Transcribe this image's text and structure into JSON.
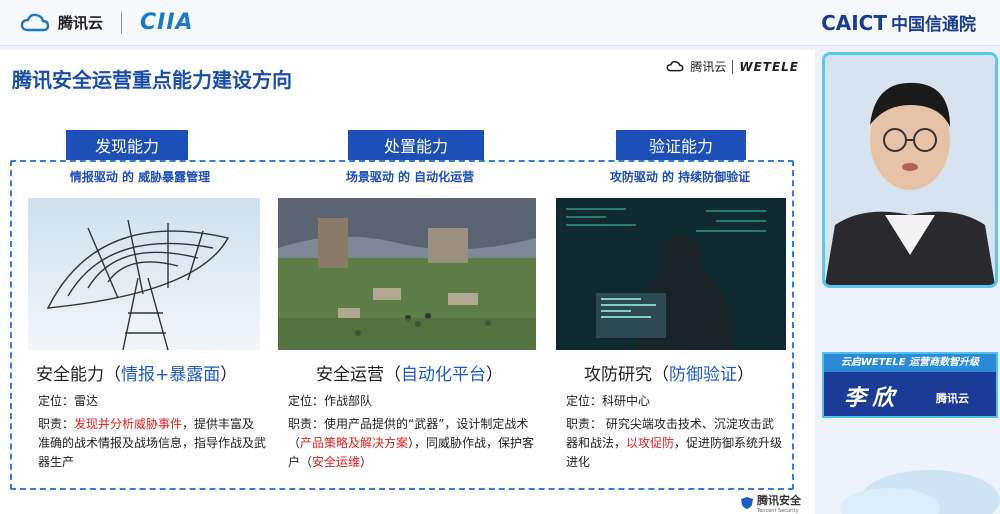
{
  "header": {
    "brand_name": "腾讯云",
    "event_logo": "CIIA",
    "org_en": "CAICT",
    "org_cn": "中国信通院"
  },
  "slide": {
    "title": "腾讯安全运营重点能力建设方向",
    "logo_brand": "腾讯云",
    "logo_partner": "WETELE",
    "footer_brand": "腾讯安全",
    "footer_brand_en": "Tencent Security",
    "columns": [
      {
        "capability": "发现能力",
        "subtitle": "情报驱动 的 威胁暴露管理",
        "image": "radar-image",
        "title_main": "安全能力（",
        "title_highlight": "情报+暴露面",
        "title_end": "）",
        "position": "定位：雷达",
        "duty_prefix": "职责：",
        "duty_red": "发现并分析威胁事件",
        "duty_rest": "，提供丰富及准确的战术情报及战场信息，指导作战及武器生产"
      },
      {
        "capability": "处置能力",
        "subtitle": "场景驱动 的 自动化运营",
        "image": "battlefield-image",
        "title_main": "安全运营（",
        "title_highlight": "自动化平台",
        "title_end": "）",
        "position": "定位：作战部队",
        "duty_prefix": "职责：使用产品提供的“武器”，设计制定战术（",
        "duty_red": "产品策略及解决方案",
        "duty_mid": "），同威胁作战，保护客户（",
        "duty_red2": "安全运维",
        "duty_end": "）"
      },
      {
        "capability": "验证能力",
        "subtitle": "攻防驱动 的 持续防御验证",
        "image": "hacker-image",
        "title_main": "攻防研究（",
        "title_highlight": "防御验证",
        "title_end": "）",
        "position": "定位：科研中心",
        "duty_prefix": "职责： 研究尖端攻击技术、沉淀攻击武器和战法，",
        "duty_red": "以攻促防",
        "duty_rest": "，促进防御系统升级进化"
      }
    ]
  },
  "speaker": {
    "banner": "云启WETELE  运营商数智升级",
    "name": "李欣",
    "org": "腾讯云"
  },
  "colors": {
    "accent": "#1d4fb8",
    "highlight": "#1d5cc7",
    "red": "#e02020"
  }
}
